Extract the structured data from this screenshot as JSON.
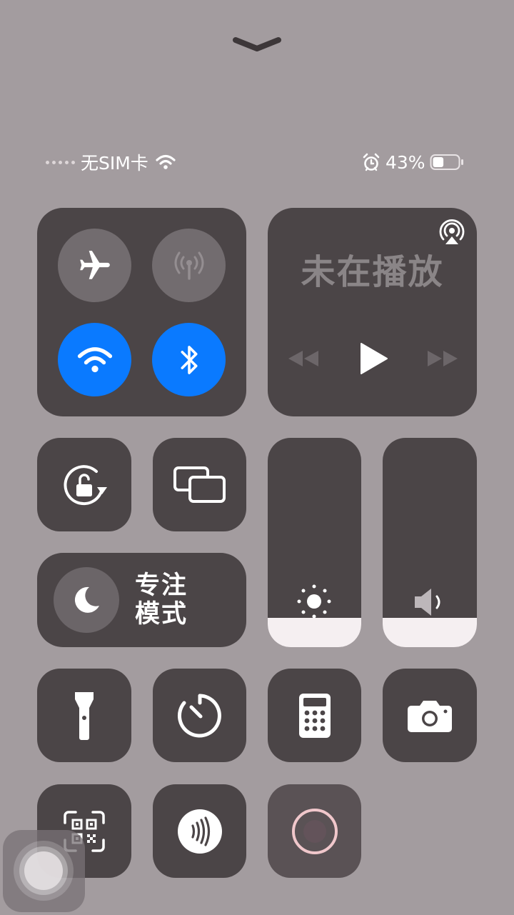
{
  "status_bar": {
    "carrier": "无SIM卡",
    "battery_percent": "43%",
    "battery_level": 0.43,
    "icons": [
      "signal-dots-icon",
      "wifi-icon",
      "alarm-icon",
      "battery-icon"
    ]
  },
  "connectivity": {
    "airplane": {
      "icon": "airplane-icon",
      "enabled": false
    },
    "cellular": {
      "icon": "cellular-antenna-icon",
      "enabled": false
    },
    "wifi": {
      "icon": "wifi-icon",
      "enabled": true,
      "color": "#0a7aff"
    },
    "bluetooth": {
      "icon": "bluetooth-icon",
      "enabled": true,
      "color": "#0a7aff"
    }
  },
  "now_playing": {
    "title": "未在播放",
    "controls": [
      "rewind-icon",
      "play-icon",
      "fast-forward-icon"
    ],
    "airplay_icon": "airplay-icon"
  },
  "focus": {
    "label_line1": "专注",
    "label_line2": "模式",
    "icon": "moon-icon"
  },
  "sliders": {
    "brightness": {
      "icon": "sun-icon",
      "level": 0.14
    },
    "volume": {
      "icon": "speaker-icon",
      "level": 0.14
    }
  },
  "tiles": [
    {
      "name": "orientation-lock-icon"
    },
    {
      "name": "screen-mirroring-icon"
    },
    {
      "name": "flashlight-icon"
    },
    {
      "name": "timer-icon"
    },
    {
      "name": "calculator-icon"
    },
    {
      "name": "camera-icon"
    },
    {
      "name": "qr-scanner-icon"
    },
    {
      "name": "nfc-wallet-icon"
    },
    {
      "name": "screen-record-icon"
    }
  ]
}
